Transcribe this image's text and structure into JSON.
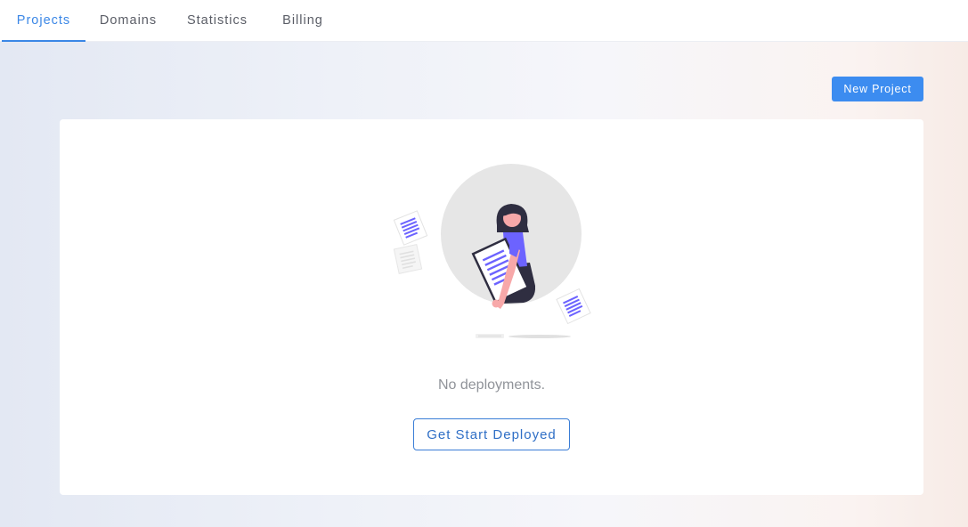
{
  "nav": {
    "tabs": [
      {
        "label": "Projects",
        "active": true
      },
      {
        "label": "Domains",
        "active": false
      },
      {
        "label": "Statistics",
        "active": false
      },
      {
        "label": "Billing",
        "active": false
      }
    ]
  },
  "toolbar": {
    "new_project_label": "New Project"
  },
  "empty_state": {
    "illustration": "woman-holding-document-illustration",
    "message": "No deployments.",
    "action_label": "Get Start Deployed"
  },
  "colors": {
    "accent": "#3c8cf0",
    "illustration_purple": "#6c63ff",
    "illustration_dark": "#2f2e41",
    "skin": "#f7a8a9"
  }
}
